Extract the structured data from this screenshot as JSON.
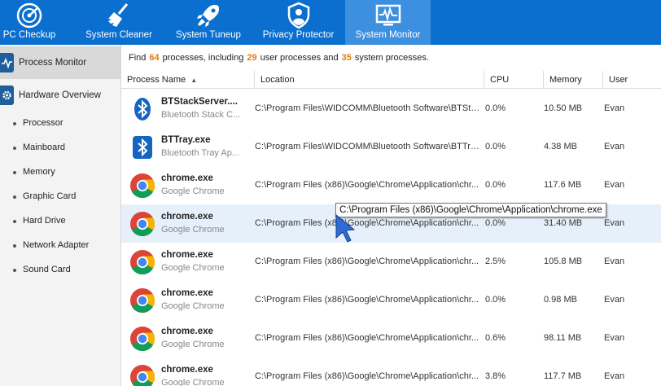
{
  "nav": {
    "tabs": [
      {
        "label": "PC Checkup",
        "icon": "radar-icon",
        "active": false
      },
      {
        "label": "System Cleaner",
        "icon": "broom-icon",
        "active": false
      },
      {
        "label": "System Tuneup",
        "icon": "rocket-icon",
        "active": false
      },
      {
        "label": "Privacy Protector",
        "icon": "shield-person-icon",
        "active": false
      },
      {
        "label": "System Monitor",
        "icon": "monitor-pulse-icon",
        "active": true
      }
    ]
  },
  "sidebar": {
    "process_monitor": "Process Monitor",
    "hardware_overview": "Hardware Overview",
    "hardware_items": [
      "Processor",
      "Mainboard",
      "Memory",
      "Graphic Card",
      "Hard Drive",
      "Network Adapter",
      "Sound Card"
    ]
  },
  "summary": {
    "prefix": "Find",
    "total": "64",
    "mid": "processes, including",
    "user_count": "29",
    "mid2": "user processes and",
    "system_count": "35",
    "suffix": "system processes."
  },
  "table": {
    "columns": [
      "Process Name",
      "Location",
      "CPU",
      "Memory",
      "User"
    ],
    "sort_indicator": "▲",
    "rows": [
      {
        "name": "BTStackServer....",
        "desc": "Bluetooth Stack C...",
        "location": "C:\\Program Files\\WIDCOMM\\Bluetooth Software\\BTSta...",
        "cpu": "0.0%",
        "memory": "10.50 MB",
        "user": "Evan",
        "icon": "bluetooth-icon"
      },
      {
        "name": "BTTray.exe",
        "desc": "Bluetooth Tray Ap...",
        "location": "C:\\Program Files\\WIDCOMM\\Bluetooth Software\\BTTra...",
        "cpu": "0.0%",
        "memory": "4.38 MB",
        "user": "Evan",
        "icon": "bluetooth-icon"
      },
      {
        "name": "chrome.exe",
        "desc": "Google Chrome",
        "location": "C:\\Program Files (x86)\\Google\\Chrome\\Application\\chr...",
        "cpu": "0.0%",
        "memory": "117.6 MB",
        "user": "Evan",
        "icon": "chrome-icon"
      },
      {
        "name": "chrome.exe",
        "desc": "Google Chrome",
        "location": "C:\\Program Files (x86)\\Google\\Chrome\\Application\\chr...",
        "cpu": "0.0%",
        "memory": "31.40 MB",
        "user": "Evan",
        "icon": "chrome-icon"
      },
      {
        "name": "chrome.exe",
        "desc": "Google Chrome",
        "location": "C:\\Program Files (x86)\\Google\\Chrome\\Application\\chr...",
        "cpu": "2.5%",
        "memory": "105.8 MB",
        "user": "Evan",
        "icon": "chrome-icon"
      },
      {
        "name": "chrome.exe",
        "desc": "Google Chrome",
        "location": "C:\\Program Files (x86)\\Google\\Chrome\\Application\\chr...",
        "cpu": "0.0%",
        "memory": "0.98 MB",
        "user": "Evan",
        "icon": "chrome-icon"
      },
      {
        "name": "chrome.exe",
        "desc": "Google Chrome",
        "location": "C:\\Program Files (x86)\\Google\\Chrome\\Application\\chr...",
        "cpu": "0.6%",
        "memory": "98.11 MB",
        "user": "Evan",
        "icon": "chrome-icon"
      },
      {
        "name": "chrome.exe",
        "desc": "Google Chrome",
        "location": "C:\\Program Files (x86)\\Google\\Chrome\\Application\\chr...",
        "cpu": "3.8%",
        "memory": "117.7 MB",
        "user": "Evan",
        "icon": "chrome-icon"
      }
    ]
  },
  "tooltip": "C:\\Program Files (x86)\\Google\\Chrome\\Application\\chrome.exe",
  "colors": {
    "topbar": "#0a6fce",
    "active_tab": "#3d8fe0",
    "count_highlight": "#e57b0c",
    "row_highlight": "#e6f0fb"
  }
}
